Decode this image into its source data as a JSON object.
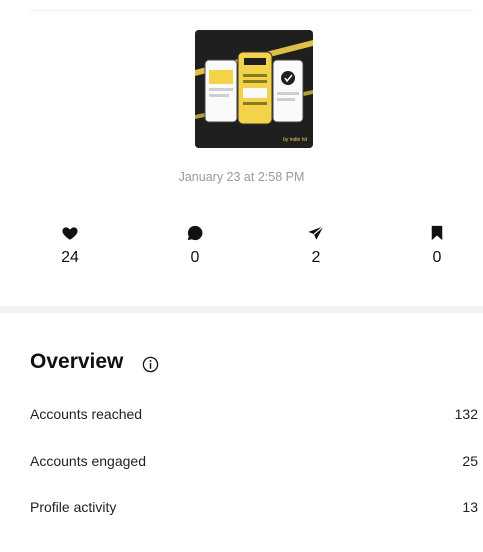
{
  "post": {
    "thumbnail_caption": "by indie hit",
    "date": "January 23 at 2:58 PM"
  },
  "stats": [
    {
      "icon": "heart-icon",
      "count": "24"
    },
    {
      "icon": "comment-icon",
      "count": "0"
    },
    {
      "icon": "share-icon",
      "count": "2"
    },
    {
      "icon": "bookmark-icon",
      "count": "0"
    }
  ],
  "overview": {
    "title": "Overview",
    "rows": [
      {
        "label": "Accounts reached",
        "value": "132"
      },
      {
        "label": "Accounts engaged",
        "value": "25"
      },
      {
        "label": "Profile activity",
        "value": "13"
      }
    ]
  },
  "colors": {
    "thumbnail_bg": "#1f1f1f",
    "thumbnail_accent": "#f2d34a",
    "muted_text": "#9a9a9a"
  }
}
